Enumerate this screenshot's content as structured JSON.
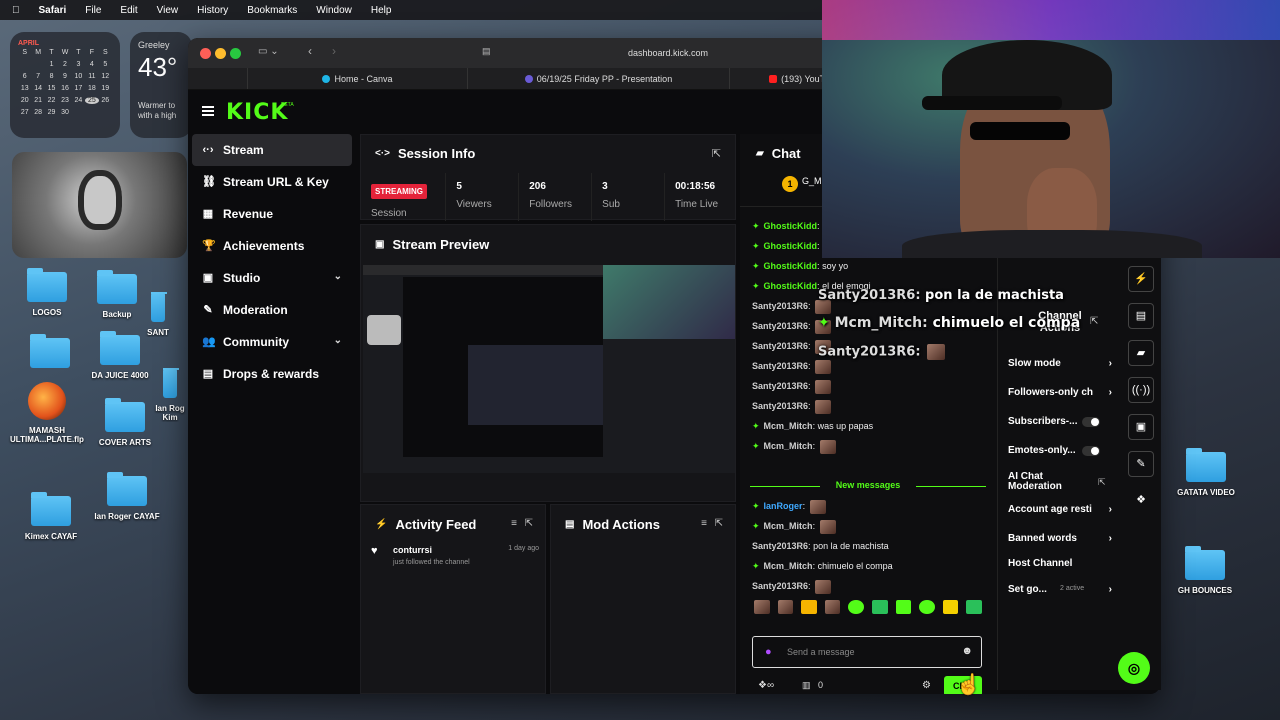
{
  "menubar": {
    "app": "Safari",
    "items": [
      "File",
      "Edit",
      "View",
      "History",
      "Bookmarks",
      "Window",
      "Help"
    ]
  },
  "calendar": {
    "month": "APRIL",
    "weekdays": [
      "S",
      "M",
      "T",
      "W",
      "T",
      "F",
      "S"
    ],
    "days": [
      "",
      "",
      "1",
      "2",
      "3",
      "4",
      "5",
      "6",
      "7",
      "8",
      "9",
      "10",
      "11",
      "12",
      "13",
      "14",
      "15",
      "16",
      "17",
      "18",
      "19",
      "20",
      "21",
      "22",
      "23",
      "24",
      "25",
      "26",
      "27",
      "28",
      "29",
      "30",
      "",
      "",
      ""
    ],
    "today": "25"
  },
  "weather": {
    "city": "Greeley",
    "temp": "43°",
    "desc": "Warmer to with a high"
  },
  "desktop": {
    "icons": [
      "LOGOS",
      "Backup",
      "SANT",
      "DA JUICE 4000",
      "MAMASH ULTIMA...PLATE.flp",
      "COVER ARTS",
      "Ian Rog Kim",
      "Kimex CAYAF",
      "Ian Roger CAYAF",
      "GATATA VIDEO",
      "GH BOUNCES"
    ]
  },
  "browser": {
    "url": "dashboard.kick.com",
    "tabs": [
      {
        "label": "Home - Canva",
        "color": "#1fb5e6"
      },
      {
        "label": "06/19/25 Friday PP - Presentation",
        "color": "#6a5bd6"
      },
      {
        "label": "(193) YouTu",
        "color": "#ff2020"
      }
    ]
  },
  "kick": {
    "logo": "KICK",
    "logo_beta": "BETA",
    "nav": [
      {
        "label": "Stream",
        "icon": "stream-icon",
        "glyph": "‹·›",
        "active": true,
        "chevron": false
      },
      {
        "label": "Stream URL & Key",
        "icon": "link-icon",
        "glyph": "⛓",
        "active": false,
        "chevron": false
      },
      {
        "label": "Revenue",
        "icon": "revenue-icon",
        "glyph": "▦",
        "active": false,
        "chevron": false
      },
      {
        "label": "Achievements",
        "icon": "trophy-icon",
        "glyph": "🏆",
        "active": false,
        "chevron": false
      },
      {
        "label": "Studio",
        "icon": "studio-icon",
        "glyph": "▣",
        "active": false,
        "chevron": true
      },
      {
        "label": "Moderation",
        "icon": "wrench-icon",
        "glyph": "✎",
        "active": false,
        "chevron": false
      },
      {
        "label": "Community",
        "icon": "community-icon",
        "glyph": "👥",
        "active": false,
        "chevron": true
      },
      {
        "label": "Drops & rewards",
        "icon": "drops-icon",
        "glyph": "▤",
        "active": false,
        "chevron": false
      }
    ],
    "session": {
      "title": "Session Info",
      "status": "STREAMING",
      "status_label": "Session",
      "stats": [
        {
          "value": "5",
          "label": "Viewers"
        },
        {
          "value": "206",
          "label": "Followers"
        },
        {
          "value": "3",
          "label": "Sub"
        },
        {
          "value": "00:18:56",
          "label": "Time Live"
        }
      ]
    },
    "preview": {
      "title": "Stream Preview"
    },
    "activity": {
      "title": "Activity Feed",
      "items": [
        {
          "user": "conturrsi",
          "time": "1 day ago",
          "text": "just followed the channel"
        }
      ]
    },
    "modactions": {
      "title": "Mod Actions"
    },
    "chat": {
      "title": "Chat",
      "top_user": "G_M",
      "messages": [
        {
          "user": "GhosticKidd",
          "text": "",
          "color": "#53fc18",
          "badge": true,
          "emote": false
        },
        {
          "user": "GhosticKidd",
          "text": "",
          "color": "#53fc18",
          "badge": true,
          "emote": true
        },
        {
          "user": "GhosticKidd",
          "text": "soy yo",
          "color": "#53fc18",
          "badge": true,
          "emote": false
        },
        {
          "user": "GhosticKidd",
          "text": "el del emogi",
          "color": "#53fc18",
          "badge": true,
          "emote": false
        },
        {
          "user": "Santy2013R6",
          "text": "",
          "color": "#cfcfcf",
          "badge": false,
          "emote": true
        },
        {
          "user": "Santy2013R6",
          "text": "",
          "color": "#cfcfcf",
          "badge": false,
          "emote": true
        },
        {
          "user": "Santy2013R6",
          "text": "",
          "color": "#cfcfcf",
          "badge": false,
          "emote": true
        },
        {
          "user": "Santy2013R6",
          "text": "",
          "color": "#cfcfcf",
          "badge": false,
          "emote": true
        },
        {
          "user": "Santy2013R6",
          "text": "",
          "color": "#cfcfcf",
          "badge": false,
          "emote": true
        },
        {
          "user": "Santy2013R6",
          "text": "",
          "color": "#cfcfcf",
          "badge": false,
          "emote": true
        },
        {
          "user": "Mcm_Mitch",
          "text": "was up papas",
          "color": "#cfcfcf",
          "badge": true,
          "emote": false
        },
        {
          "user": "Mcm_Mitch",
          "text": "",
          "color": "#cfcfcf",
          "badge": true,
          "emote": true
        }
      ],
      "new_messages_label": "New messages",
      "new_messages": [
        {
          "user": "IanRoger",
          "text": "",
          "color": "#3fa9ff",
          "badge": true,
          "emote": true
        },
        {
          "user": "Mcm_Mitch",
          "text": "",
          "color": "#cfcfcf",
          "badge": true,
          "emote": true
        },
        {
          "user": "Santy2013R6",
          "text": "pon la de machista",
          "color": "#cfcfcf",
          "badge": false,
          "emote": false
        },
        {
          "user": "Mcm_Mitch",
          "text": "chimuelo el compa",
          "color": "#cfcfcf",
          "badge": true,
          "emote": false
        },
        {
          "user": "Santy2013R6",
          "text": "",
          "color": "#cfcfcf",
          "badge": false,
          "emote": true
        }
      ],
      "input_placeholder": "Send a message",
      "count": "0",
      "send_label": "Chat"
    },
    "overlay": {
      "line1_user": "Santy2013R6:",
      "line1_text": "pon la de machista",
      "line2_user": "Mcm_Mitch:",
      "line2_text": "chimuelo el compa",
      "line3_user": "Santy2013R6:"
    },
    "channel_actions": {
      "title": "Channel Actions",
      "items": [
        {
          "label": "Slow mode",
          "type": "arrow"
        },
        {
          "label": "Followers-only ch",
          "type": "arrow"
        },
        {
          "label": "Subscribers-...",
          "type": "toggle"
        },
        {
          "label": "Emotes-only...",
          "type": "toggle"
        },
        {
          "label": "AI Chat Moderation",
          "type": "link"
        },
        {
          "label": "Account age resti",
          "type": "arrow"
        },
        {
          "label": "Banned words",
          "type": "arrow"
        },
        {
          "label": "Host Channel",
          "type": "none"
        },
        {
          "label": "Set go...",
          "type": "arrow",
          "extra": "2 active"
        }
      ]
    }
  }
}
